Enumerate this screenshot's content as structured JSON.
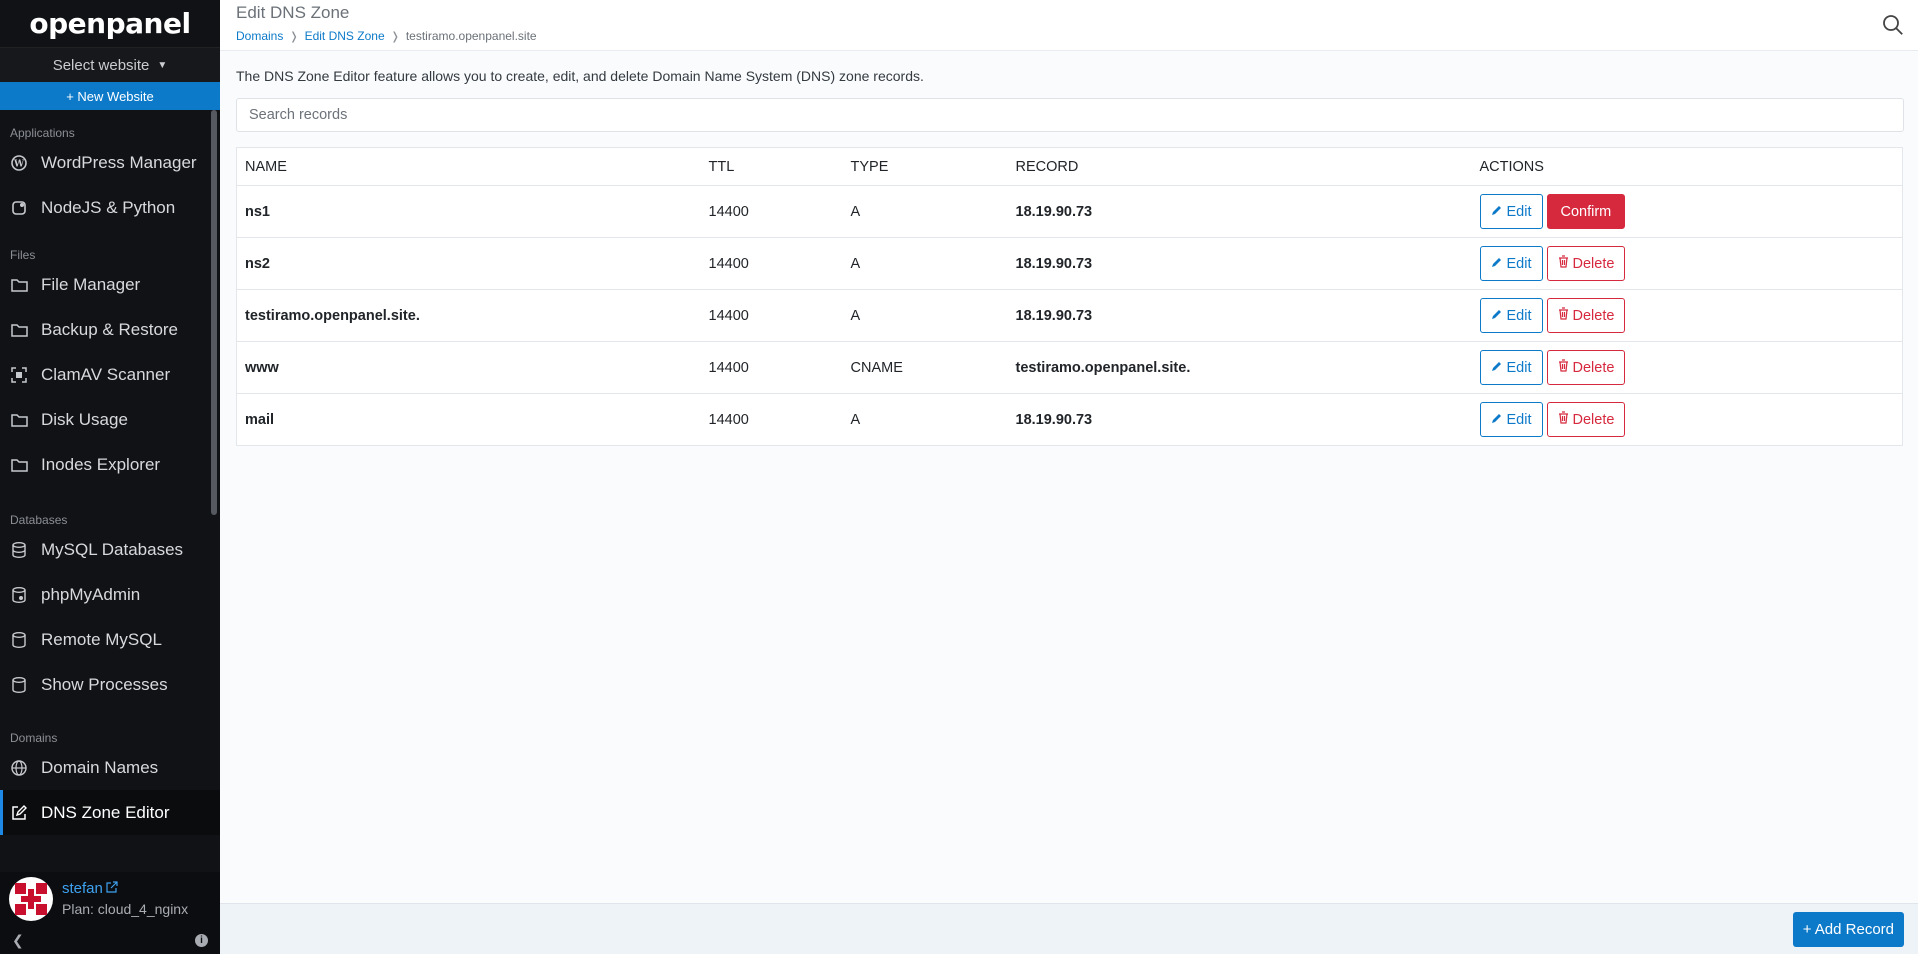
{
  "sidebar": {
    "brand": "openpanel",
    "site_select": "Select website",
    "new_website": "+ New Website",
    "sections": {
      "applications": "Applications",
      "files": "Files",
      "databases": "Databases",
      "domains": "Domains"
    },
    "items": {
      "wordpress": "WordPress Manager",
      "nodejs": "NodeJS & Python",
      "file_manager": "File Manager",
      "backup": "Backup & Restore",
      "clamav": "ClamAV Scanner",
      "disk_usage": "Disk Usage",
      "inodes": "Inodes Explorer",
      "mysql": "MySQL Databases",
      "phpmyadmin": "phpMyAdmin",
      "remote_mysql": "Remote MySQL",
      "processes": "Show Processes",
      "domain_names": "Domain Names",
      "dns_zone": "DNS Zone Editor"
    },
    "user": {
      "name": "stefan",
      "plan": "Plan: cloud_4_nginx"
    },
    "footer_info": "i"
  },
  "header": {
    "title": "Edit DNS Zone",
    "breadcrumb": [
      "Domains",
      "Edit DNS Zone",
      "testiramo.openpanel.site"
    ]
  },
  "main": {
    "description": "The DNS Zone Editor feature allows you to create, edit, and delete Domain Name System (DNS) zone records.",
    "search_placeholder": "Search records",
    "columns": {
      "name": "NAME",
      "ttl": "TTL",
      "type": "TYPE",
      "record": "RECORD",
      "actions": "ACTIONS"
    },
    "edit_label": "Edit",
    "delete_label": "Delete",
    "confirm_label": "Confirm",
    "records": [
      {
        "name": "ns1",
        "ttl": "14400",
        "type": "A",
        "record": "18.19.90.73"
      },
      {
        "name": "ns2",
        "ttl": "14400",
        "type": "A",
        "record": "18.19.90.73"
      },
      {
        "name": "testiramo.openpanel.site.",
        "ttl": "14400",
        "type": "A",
        "record": "18.19.90.73"
      },
      {
        "name": "www",
        "ttl": "14400",
        "type": "CNAME",
        "record": "testiramo.openpanel.site."
      },
      {
        "name": "mail",
        "ttl": "14400",
        "type": "A",
        "record": "18.19.90.73"
      }
    ]
  },
  "footer": {
    "add_record": "+ Add Record"
  },
  "colors": {
    "primary": "#0d7ac9",
    "danger": "#d6293e",
    "sidebar_bg": "#111215"
  }
}
